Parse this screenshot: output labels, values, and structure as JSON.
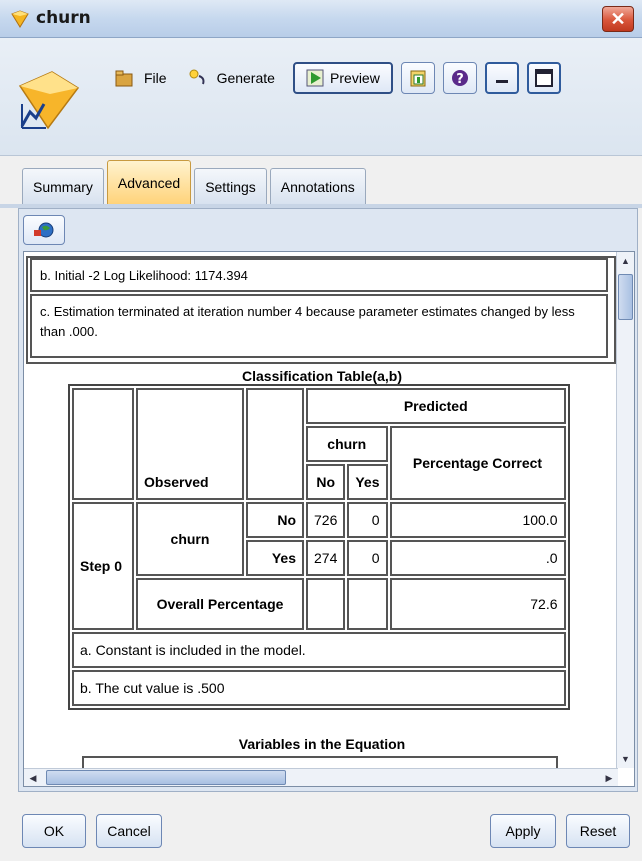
{
  "window": {
    "title": "churn",
    "close_glyph": "✕"
  },
  "toolbar": {
    "file_label": "File",
    "generate_label": "Generate",
    "preview_label": "Preview",
    "icons": [
      "file-icon",
      "generate-icon",
      "preview-icon",
      "clipboard-icon",
      "help-icon",
      "minimize-icon",
      "maximize-icon"
    ]
  },
  "tabs": [
    {
      "label": "Summary",
      "active": false
    },
    {
      "label": "Advanced",
      "active": true
    },
    {
      "label": "Settings",
      "active": false
    },
    {
      "label": "Annotations",
      "active": false
    }
  ],
  "notes": {
    "b": "b. Initial -2 Log Likelihood: 1174.394",
    "c": "c. Estimation terminated at iteration number 4 because parameter estimates changed by less than .000."
  },
  "classification": {
    "title": "Classification Table(a,b)",
    "predicted": "Predicted",
    "churn_header": "churn",
    "pct_correct_header": "Percentage Correct",
    "observed": "Observed",
    "no_col": "No",
    "yes_col": "Yes",
    "step": "Step 0",
    "row_var": "churn",
    "row_no": {
      "label": "No",
      "no": "726",
      "yes": "0",
      "pct": "100.0"
    },
    "row_yes": {
      "label": "Yes",
      "no": "274",
      "yes": "0",
      "pct": ".0"
    },
    "overall": {
      "label": "Overall Percentage",
      "pct": "72.6"
    },
    "footnote_a": "a. Constant is included in the model.",
    "footnote_b": "b. The cut value is .500"
  },
  "variables_title": "Variables in the Equation",
  "buttons": {
    "ok": "OK",
    "cancel": "Cancel",
    "apply": "Apply",
    "reset": "Reset"
  },
  "colors": {
    "active_tab": "#ffd37a",
    "titlebar": "#c6d8ee",
    "close": "#d9553a"
  }
}
